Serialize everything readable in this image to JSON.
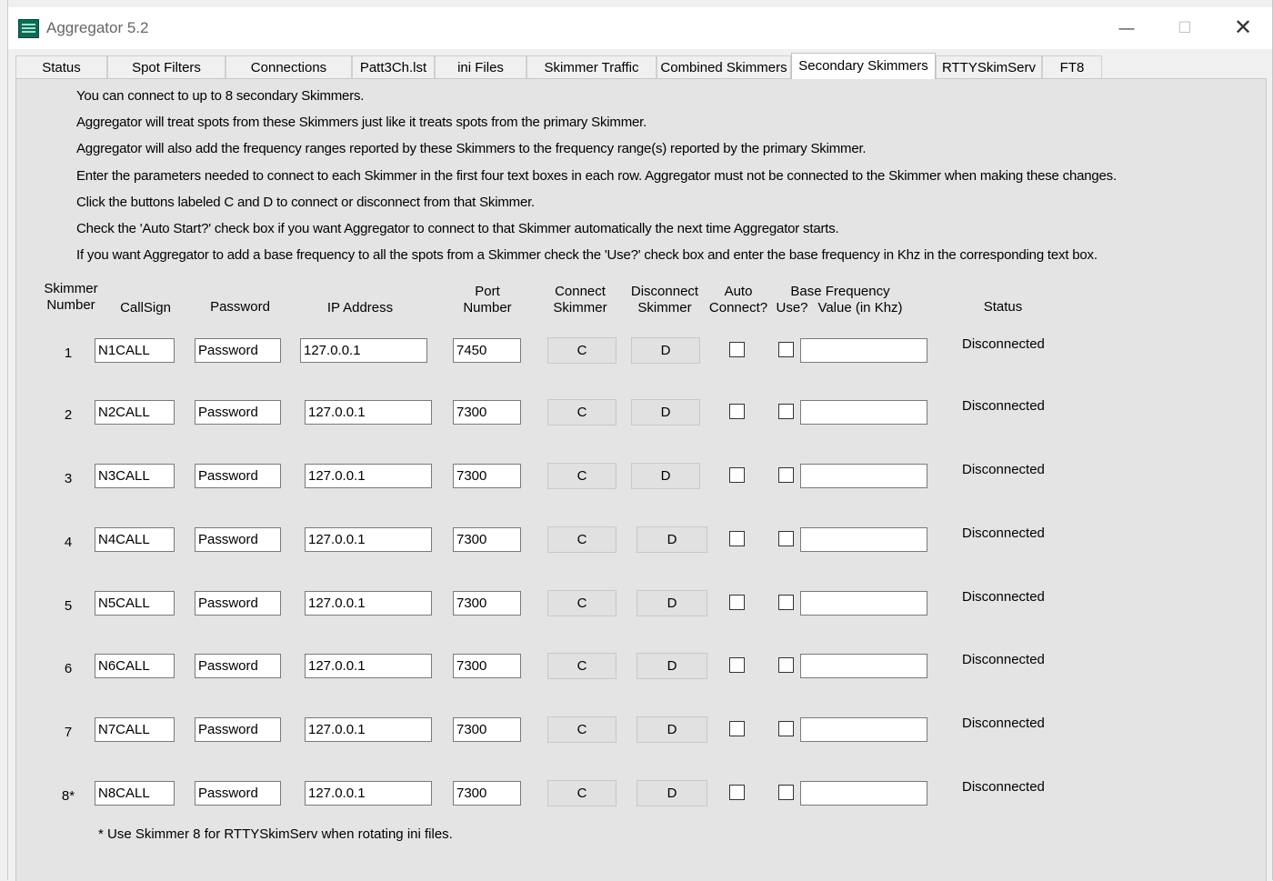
{
  "window": {
    "title": "Aggregator 5.2",
    "minimize": "—",
    "maximize": "☐",
    "close": "✕"
  },
  "tabs": [
    {
      "label": "Status"
    },
    {
      "label": "Spot Filters"
    },
    {
      "label": "Connections"
    },
    {
      "label": "Patt3Ch.lst"
    },
    {
      "label": "ini Files"
    },
    {
      "label": "Skimmer Traffic"
    },
    {
      "label": "Combined Skimmers"
    },
    {
      "label": "Secondary Skimmers",
      "active": true
    },
    {
      "label": "RTTYSkimServ"
    },
    {
      "label": "FT8"
    }
  ],
  "info": [
    "You can connect to up to 8 secondary Skimmers.",
    "Aggregator will treat spots from these Skimmers just like it treats spots from the primary Skimmer.",
    "Aggregator will also add the frequency ranges reported by these Skimmers to the frequency range(s) reported by the primary Skimmer.",
    "Enter the parameters needed to connect to each Skimmer in the first four text boxes in each row.  Aggregator must not be connected to the Skimmer when making these changes.",
    "Click the buttons labeled C and D to connect or disconnect from that Skimmer.",
    "Check the 'Auto Start?' check box if you want Aggregator to connect to that Skimmer automatically the next time Aggregator starts.",
    "If you want Aggregator to add a base frequency to all the spots from a Skimmer check the 'Use?' check box and enter the base frequency in Khz in the corresponding text box."
  ],
  "headers": {
    "skimmer_number_1": "Skimmer",
    "skimmer_number_2": "Number",
    "callsign": "CallSign",
    "password": "Password",
    "ip_address": "IP Address",
    "port_1": "Port",
    "port_2": "Number",
    "connect_1": "Connect",
    "connect_2": "Skimmer",
    "disconnect_1": "Disconnect",
    "disconnect_2": "Skimmer",
    "auto_1": "Auto",
    "auto_2": "Connect?",
    "base_freq": "Base Frequency",
    "use": "Use?",
    "value": "Value (in Khz)",
    "status": "Status"
  },
  "rows": [
    {
      "number": "1",
      "callsign": "N1CALL",
      "password": "Password",
      "ip": "127.0.0.1",
      "port": "7450",
      "connect": "C",
      "disconnect": "D",
      "auto": false,
      "use": false,
      "base_freq": "",
      "status": "Disconnected"
    },
    {
      "number": "2",
      "callsign": "N2CALL",
      "password": "Password",
      "ip": "127.0.0.1",
      "port": "7300",
      "connect": "C",
      "disconnect": "D",
      "auto": false,
      "use": false,
      "base_freq": "",
      "status": "Disconnected"
    },
    {
      "number": "3",
      "callsign": "N3CALL",
      "password": "Password",
      "ip": "127.0.0.1",
      "port": "7300",
      "connect": "C",
      "disconnect": "D",
      "auto": false,
      "use": false,
      "base_freq": "",
      "status": "Disconnected"
    },
    {
      "number": "4",
      "callsign": "N4CALL",
      "password": "Password",
      "ip": "127.0.0.1",
      "port": "7300",
      "connect": "C",
      "disconnect": "D",
      "auto": false,
      "use": false,
      "base_freq": "",
      "status": "Disconnected"
    },
    {
      "number": "5",
      "callsign": "N5CALL",
      "password": "Password",
      "ip": "127.0.0.1",
      "port": "7300",
      "connect": "C",
      "disconnect": "D",
      "auto": false,
      "use": false,
      "base_freq": "",
      "status": "Disconnected"
    },
    {
      "number": "6",
      "callsign": "N6CALL",
      "password": "Password",
      "ip": "127.0.0.1",
      "port": "7300",
      "connect": "C",
      "disconnect": "D",
      "auto": false,
      "use": false,
      "base_freq": "",
      "status": "Disconnected"
    },
    {
      "number": "7",
      "callsign": "N7CALL",
      "password": "Password",
      "ip": "127.0.0.1",
      "port": "7300",
      "connect": "C",
      "disconnect": "D",
      "auto": false,
      "use": false,
      "base_freq": "",
      "status": "Disconnected"
    },
    {
      "number": "8*",
      "callsign": "N8CALL",
      "password": "Password",
      "ip": "127.0.0.1",
      "port": "7300",
      "connect": "C",
      "disconnect": "D",
      "auto": false,
      "use": false,
      "base_freq": "",
      "status": "Disconnected"
    }
  ],
  "footnote": "* Use Skimmer 8 for RTTYSkimServ when rotating ini files."
}
